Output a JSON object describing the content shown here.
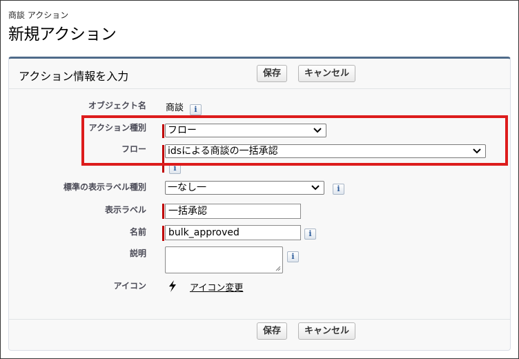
{
  "header": {
    "breadcrumb": "商談 アクション",
    "title": "新規アクション"
  },
  "panel": {
    "title": "アクション情報を入力",
    "save_label": "保存",
    "cancel_label": "キャンセル"
  },
  "fields": {
    "object_name": {
      "label": "オブジェクト名",
      "value": "商談"
    },
    "action_type": {
      "label": "アクション種別",
      "value": "フロー"
    },
    "flow": {
      "label": "フロー",
      "value": "idsによる商談の一括承認"
    },
    "standard_label_type": {
      "label": "標準の表示ラベル種別",
      "value": "一なし一"
    },
    "display_label": {
      "label": "表示ラベル",
      "value": "一括承認"
    },
    "name": {
      "label": "名前",
      "value": "bulk_approved"
    },
    "description": {
      "label": "説明",
      "value": ""
    },
    "icon": {
      "label": "アイコン",
      "link_label": "アイコン変更",
      "icon_name": "lightning-bolt-icon"
    }
  },
  "info_icon_glyph": "i",
  "colors": {
    "required": "#c00000",
    "highlight": "#dd1c1c",
    "panel_border": "#4f6b8a"
  }
}
